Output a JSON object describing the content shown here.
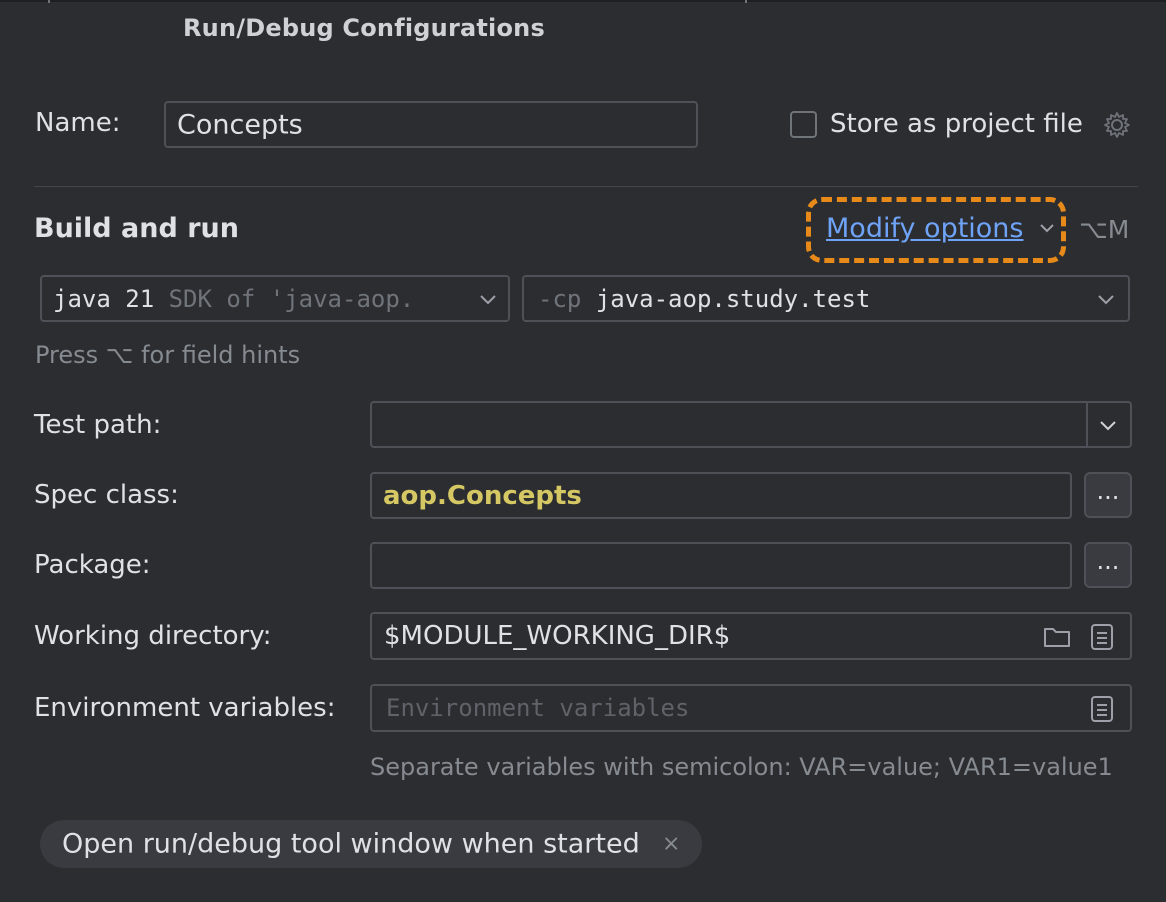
{
  "dialog": {
    "title": "Run/Debug Configurations"
  },
  "name": {
    "label": "Name:",
    "value": "Concepts"
  },
  "store": {
    "label": "Store as project file",
    "checked": false
  },
  "build": {
    "section_title": "Build and run",
    "modify_label": "Modify options",
    "modify_shortcut": "⌥M",
    "jdk": {
      "main": "java 21",
      "detail": "SDK of 'java-aop."
    },
    "cp": {
      "prefix": "-cp",
      "value": "java-aop.study.test"
    },
    "hint": "Press ⌥ for field hints"
  },
  "fields": {
    "test_path": {
      "label": "Test path:",
      "value": ""
    },
    "spec_class": {
      "label": "Spec class:",
      "value": "aop.Concepts",
      "button": "..."
    },
    "package": {
      "label": "Package:",
      "value": "",
      "button": "..."
    },
    "working_dir": {
      "label": "Working directory:",
      "value": "$MODULE_WORKING_DIR$"
    },
    "env": {
      "label": "Environment variables:",
      "placeholder": "Environment variables",
      "hint": "Separate variables with semicolon: VAR=value; VAR1=value1"
    }
  },
  "chip": {
    "label": "Open run/debug tool window when started",
    "close": "×"
  },
  "colors": {
    "accent_link": "#6fa3f7",
    "highlight": "#e88a1a",
    "class_name": "#d5c763"
  }
}
